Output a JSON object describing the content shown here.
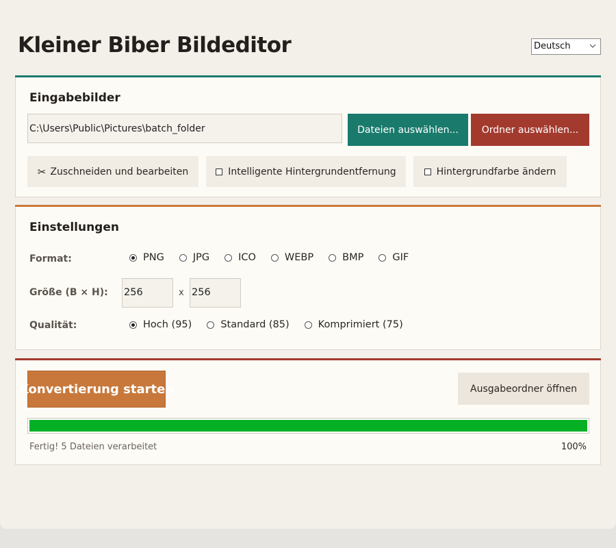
{
  "app": {
    "title": "Kleiner Biber Bildeditor",
    "language": "Deutsch"
  },
  "colors": {
    "teal": "#1a7a6c",
    "orange": "#c8783a",
    "red": "#a33a2e",
    "progress_green": "#06b025"
  },
  "input": {
    "section_title": "Eingabebilder",
    "path_value": "C:\\Users\\Public\\Pictures\\batch_folder",
    "select_files_label": "Dateien auswählen...",
    "select_folder_label": "Ordner auswählen...",
    "crop_edit_label": "Zuschneiden und bearbeiten",
    "crop_icon": "scissors-icon",
    "bg_removal_label": "Intelligente Hintergrundentfernung",
    "bg_color_label": "Hintergrundfarbe ändern"
  },
  "settings": {
    "section_title": "Einstellungen",
    "format_label": "Format:",
    "formats": [
      "PNG",
      "JPG",
      "ICO",
      "WEBP",
      "BMP",
      "GIF"
    ],
    "selected_format": "PNG",
    "size_label": "Größe (B × H):",
    "width": "256",
    "height": "256",
    "size_separator": "x",
    "quality_label": "Qualität:",
    "qualities": [
      "Hoch (95)",
      "Standard (85)",
      "Komprimiert (75)"
    ],
    "selected_quality": "Hoch (95)"
  },
  "action": {
    "start_label": "Konvertierung starten",
    "open_output_label": "Ausgabeordner öffnen",
    "progress": 1.0,
    "status": "Fertig! 5 Dateien verarbeitet",
    "percent": "100%"
  }
}
